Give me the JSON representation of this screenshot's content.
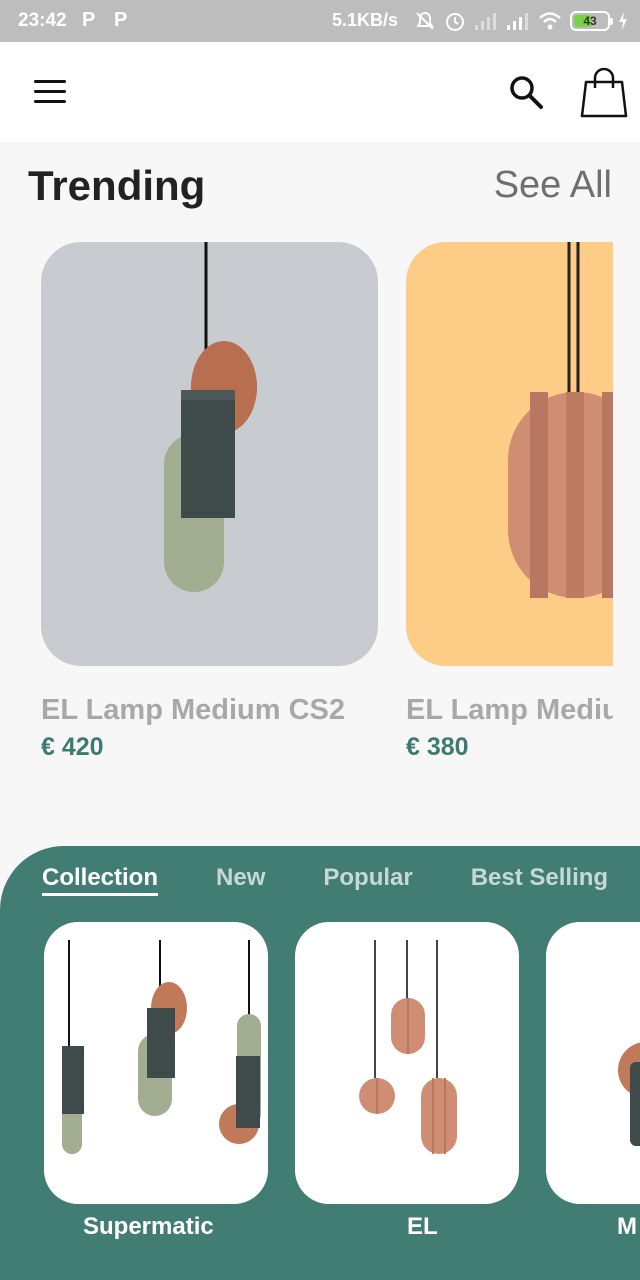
{
  "status_bar": {
    "time": "23:42",
    "notif_icons": [
      "P",
      "P"
    ],
    "net_speed": "5.1KB/s",
    "battery": "43",
    "icons": [
      "mute-icon",
      "alarm-icon",
      "signal-icon",
      "signal-icon",
      "wifi-icon",
      "battery-icon",
      "charging-icon"
    ]
  },
  "app_bar": {
    "icons": [
      "menu-icon",
      "search-icon",
      "shopping-bag-icon"
    ]
  },
  "trending": {
    "title": "Trending",
    "see_all": "See All",
    "items": [
      {
        "name": "EL Lamp Medium CS2",
        "price": "€ 420",
        "bg": "#c8cbd0"
      },
      {
        "name": "EL Lamp Medium",
        "price": "€ 380",
        "bg": "#fdcc86"
      }
    ]
  },
  "collections": {
    "tabs": [
      "Collection",
      "New",
      "Popular",
      "Best Selling"
    ],
    "active_tab": "Collection",
    "items": [
      {
        "label": "Supermatic"
      },
      {
        "label": "EL"
      },
      {
        "label": "M"
      }
    ]
  },
  "colors": {
    "accent": "#427d74",
    "price": "#3e7a72",
    "status_bar": "#bdbdbd"
  }
}
